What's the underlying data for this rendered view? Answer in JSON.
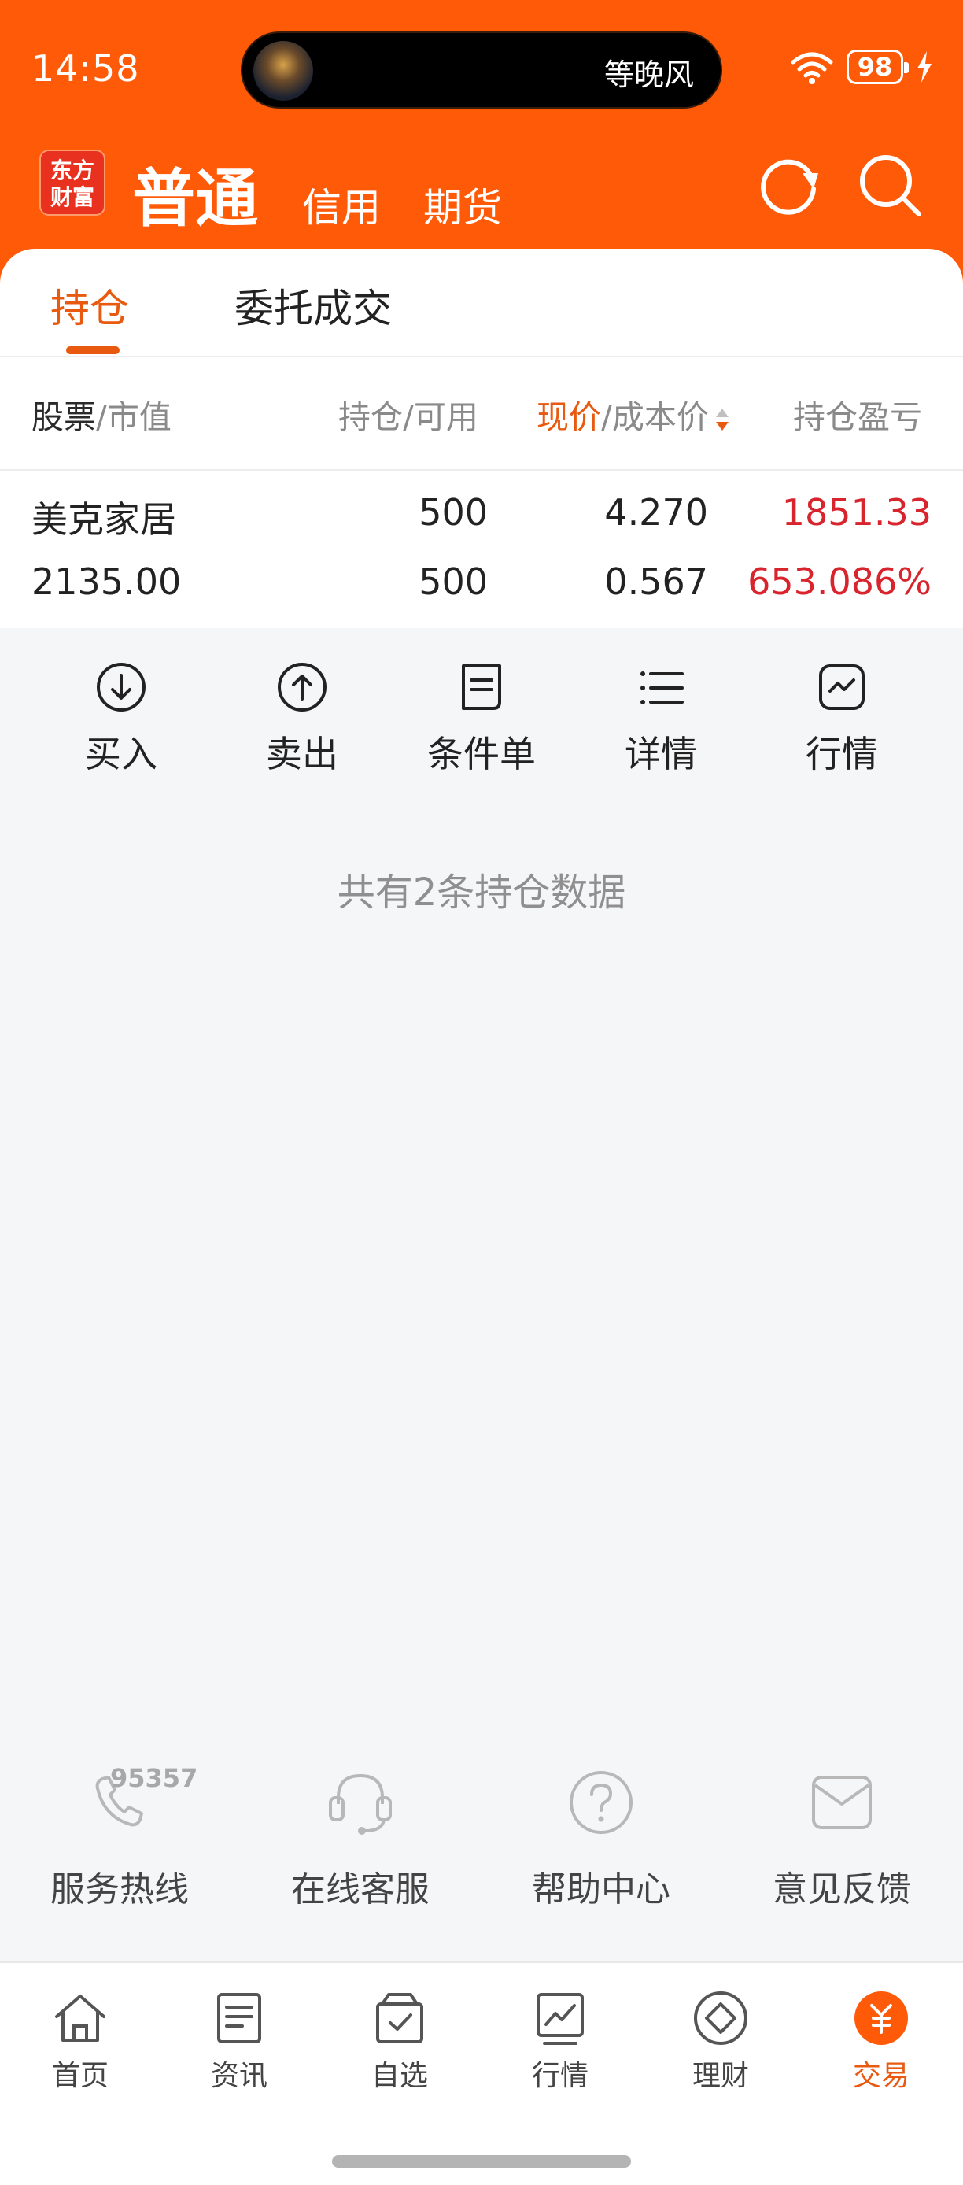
{
  "status_bar": {
    "time": "14:58",
    "now_playing": "等晚风",
    "battery": "98"
  },
  "logo": {
    "line1": "东方",
    "line2": "财富"
  },
  "account_tabs": {
    "active": "普通",
    "credit": "信用",
    "futures": "期货"
  },
  "content_tabs": {
    "holdings": "持仓",
    "orders": "委托成交"
  },
  "columns": {
    "stock": "股票",
    "market_value": "/市值",
    "holding": "持仓/可用",
    "price": "现价",
    "cost": "/成本价",
    "pnl": "持仓盈亏"
  },
  "positions": [
    {
      "name": "美克家居",
      "market_value": "2135.00",
      "holding": "500",
      "available": "500",
      "price": "4.270",
      "cost": "0.567",
      "pnl": "1851.33",
      "pnl_pct": "653.086%"
    }
  ],
  "actions": {
    "buy": "买入",
    "sell": "卖出",
    "conditional": "条件单",
    "details": "详情",
    "quote": "行情"
  },
  "summary": "共有2条持仓数据",
  "services": {
    "hotline_number": "95357",
    "hotline": "服务热线",
    "online_service": "在线客服",
    "help": "帮助中心",
    "feedback": "意见反馈"
  },
  "nav": {
    "home": "首页",
    "news": "资讯",
    "watchlist": "自选",
    "market": "行情",
    "wealth": "理财",
    "trade": "交易"
  },
  "colors": {
    "brand": "#ff5a08",
    "accent": "#e85a10",
    "gain": "#d8242c"
  }
}
